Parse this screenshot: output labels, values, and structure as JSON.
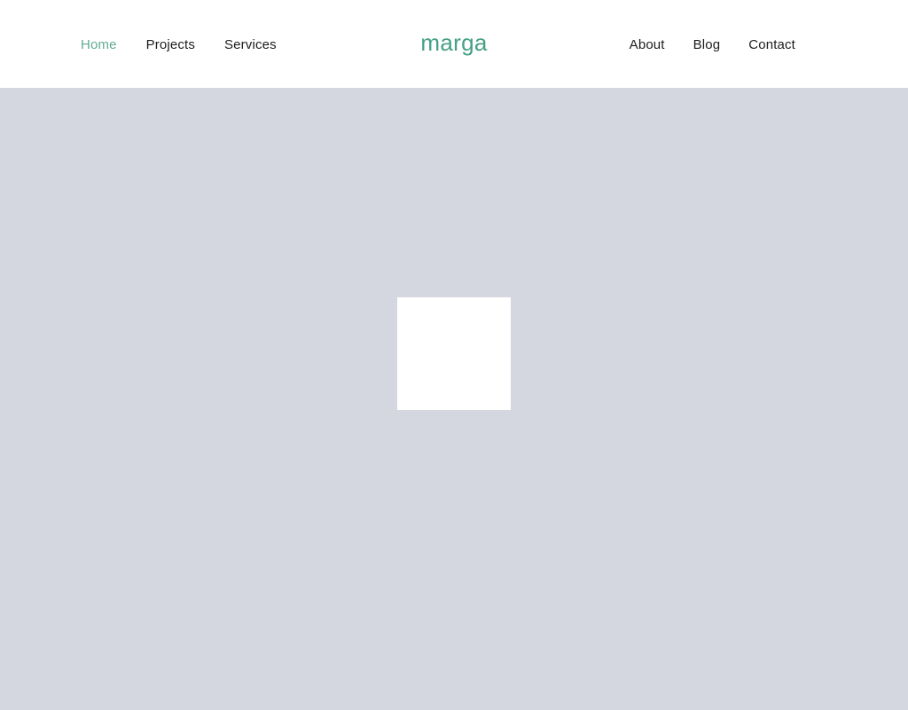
{
  "site": {
    "brand": "marga",
    "brand_color": "#45a086",
    "background_color": "#d4d7df",
    "header_background": "#ffffff"
  },
  "header": {
    "nav_left": [
      {
        "label": "Home",
        "active": true
      },
      {
        "label": "Projects",
        "active": false
      },
      {
        "label": "Services",
        "active": false
      }
    ],
    "nav_right": [
      {
        "label": "About",
        "active": false
      },
      {
        "label": "Blog",
        "active": false
      },
      {
        "label": "Contact",
        "active": false
      }
    ],
    "active_link_color": "#62ab94",
    "link_color": "#1d1d1d"
  },
  "main": {
    "hero": {
      "media_placeholder_color": "#ffffff",
      "media_width": 128,
      "media_height": 127
    }
  }
}
